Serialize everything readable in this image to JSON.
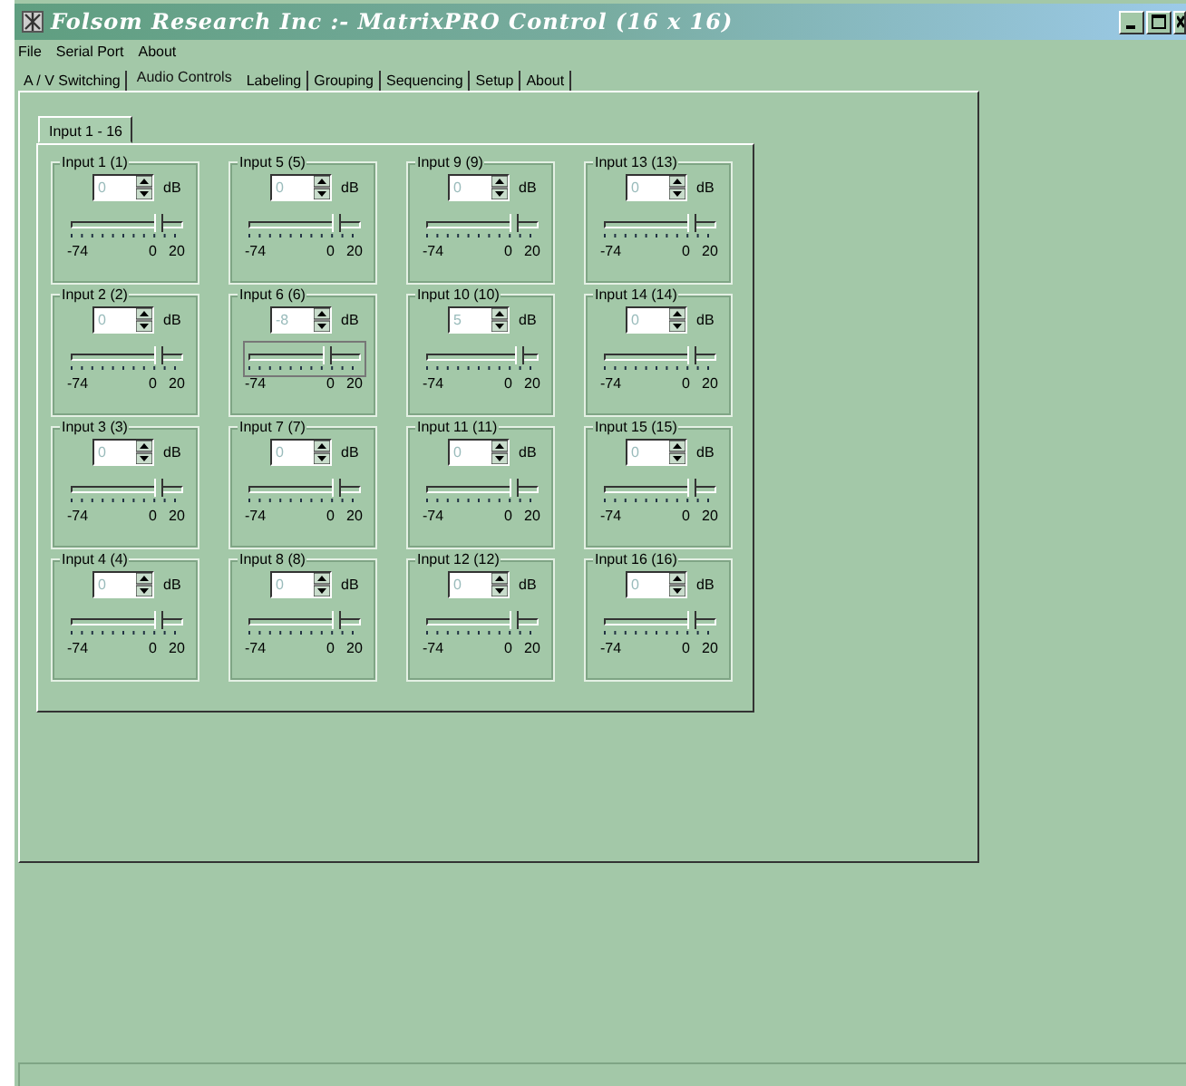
{
  "window": {
    "title": "Folsom Research Inc :- MatrixPRO  Control (16 x 16)"
  },
  "menu": [
    {
      "label": "File"
    },
    {
      "label": "Serial Port"
    },
    {
      "label": "About"
    }
  ],
  "tabs": [
    {
      "label": "A / V Switching",
      "selected": false
    },
    {
      "label": "Audio Controls",
      "selected": true
    },
    {
      "label": "Labeling",
      "selected": false
    },
    {
      "label": "Grouping",
      "selected": false
    },
    {
      "label": "Sequencing",
      "selected": false
    },
    {
      "label": "Setup",
      "selected": false
    },
    {
      "label": "About",
      "selected": false
    }
  ],
  "subtabs": [
    {
      "label": "Input 1 - 16",
      "selected": true
    }
  ],
  "inputs": [
    {
      "title": "Input 1 (1)",
      "value": "0",
      "unit": "dB",
      "level": 0.787,
      "focused": false,
      "scale": [
        "-74",
        "0",
        "20"
      ]
    },
    {
      "title": "Input 2 (2)",
      "value": "0",
      "unit": "dB",
      "level": 0.787,
      "focused": false,
      "scale": [
        "-74",
        "0",
        "20"
      ]
    },
    {
      "title": "Input 3 (3)",
      "value": "0",
      "unit": "dB",
      "level": 0.787,
      "focused": false,
      "scale": [
        "-74",
        "0",
        "20"
      ]
    },
    {
      "title": "Input 4 (4)",
      "value": "0",
      "unit": "dB",
      "level": 0.787,
      "focused": false,
      "scale": [
        "-74",
        "0",
        "20"
      ]
    },
    {
      "title": "Input 5 (5)",
      "value": "0",
      "unit": "dB",
      "level": 0.787,
      "focused": false,
      "scale": [
        "-74",
        "0",
        "20"
      ]
    },
    {
      "title": "Input 6 (6)",
      "value": "-8",
      "unit": "dB",
      "level": 0.702,
      "focused": true,
      "scale": [
        "-74",
        "0",
        "20"
      ]
    },
    {
      "title": "Input 7 (7)",
      "value": "0",
      "unit": "dB",
      "level": 0.787,
      "focused": false,
      "scale": [
        "-74",
        "0",
        "20"
      ]
    },
    {
      "title": "Input 8 (8)",
      "value": "0",
      "unit": "dB",
      "level": 0.787,
      "focused": false,
      "scale": [
        "-74",
        "0",
        "20"
      ]
    },
    {
      "title": "Input 9 (9)",
      "value": "0",
      "unit": "dB",
      "level": 0.787,
      "focused": false,
      "scale": [
        "-74",
        "0",
        "20"
      ]
    },
    {
      "title": "Input 10 (10)",
      "value": "5",
      "unit": "dB",
      "level": 0.84,
      "focused": false,
      "scale": [
        "-74",
        "0",
        "20"
      ]
    },
    {
      "title": "Input 11 (11)",
      "value": "0",
      "unit": "dB",
      "level": 0.787,
      "focused": false,
      "scale": [
        "-74",
        "0",
        "20"
      ]
    },
    {
      "title": "Input 12 (12)",
      "value": "0",
      "unit": "dB",
      "level": 0.787,
      "focused": false,
      "scale": [
        "-74",
        "0",
        "20"
      ]
    },
    {
      "title": "Input 13 (13)",
      "value": "0",
      "unit": "dB",
      "level": 0.787,
      "focused": false,
      "scale": [
        "-74",
        "0",
        "20"
      ]
    },
    {
      "title": "Input 14 (14)",
      "value": "0",
      "unit": "dB",
      "level": 0.787,
      "focused": false,
      "scale": [
        "-74",
        "0",
        "20"
      ]
    },
    {
      "title": "Input 15 (15)",
      "value": "0",
      "unit": "dB",
      "level": 0.787,
      "focused": false,
      "scale": [
        "-74",
        "0",
        "20"
      ]
    },
    {
      "title": "Input 16 (16)",
      "value": "0",
      "unit": "dB",
      "level": 0.787,
      "focused": false,
      "scale": [
        "-74",
        "0",
        "20"
      ]
    }
  ]
}
